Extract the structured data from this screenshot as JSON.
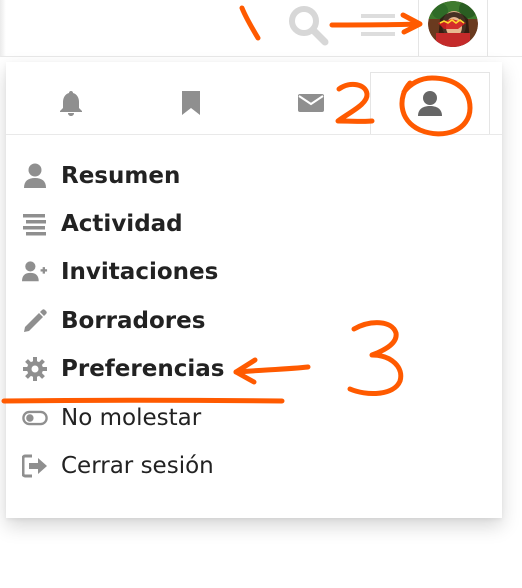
{
  "header": {
    "search_icon": "search-icon",
    "menu_icon": "hamburger-menu-icon",
    "avatar_icon": "user-avatar"
  },
  "tabs": [
    {
      "icon": "bell-icon"
    },
    {
      "icon": "bookmark-icon"
    },
    {
      "icon": "envelope-icon"
    },
    {
      "icon": "user-icon",
      "active": true
    }
  ],
  "menu": {
    "items": [
      {
        "label": "Resumen",
        "icon": "user-icon"
      },
      {
        "label": "Actividad",
        "icon": "stream-icon"
      },
      {
        "label": "Invitaciones",
        "icon": "user-plus-icon"
      },
      {
        "label": "Borradores",
        "icon": "pencil-icon"
      },
      {
        "label": "Preferencias",
        "icon": "gear-icon"
      },
      {
        "label": "No molestar",
        "icon": "toggle-off-icon"
      },
      {
        "label": "Cerrar sesión",
        "icon": "sign-out-icon"
      }
    ]
  },
  "annotations": {
    "step1": "1",
    "step2": "2",
    "step3": "3"
  },
  "colors": {
    "icon_gray": "#8f8f8f",
    "text_dark": "#222222",
    "annotation_orange": "#ff5a00"
  }
}
